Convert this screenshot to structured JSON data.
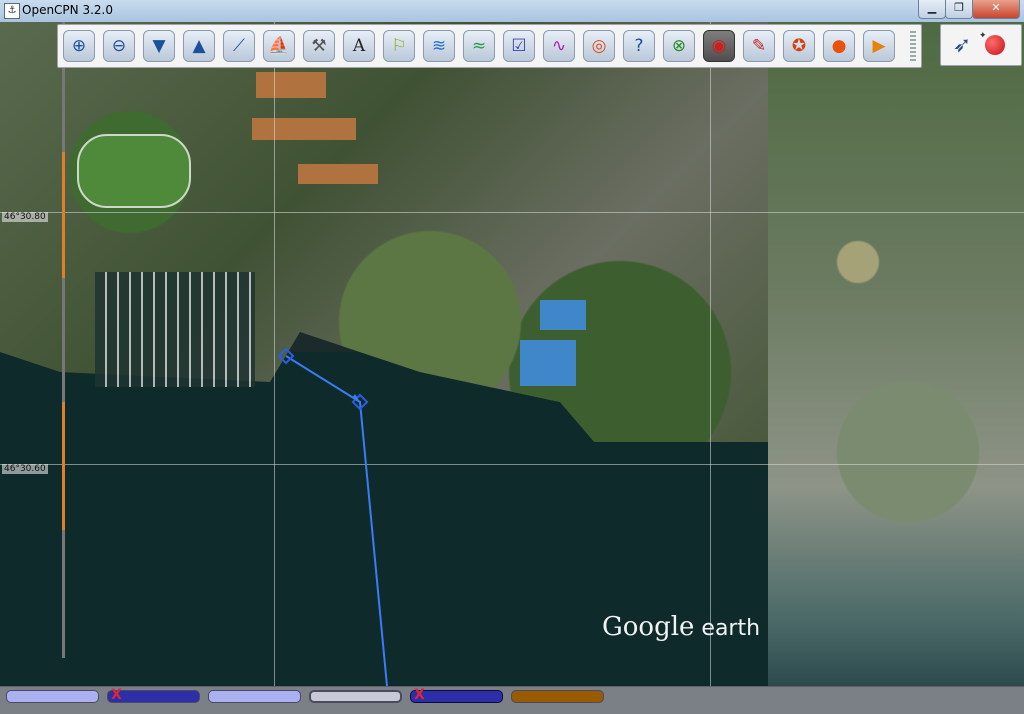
{
  "window": {
    "title": "OpenCPN 3.2.0",
    "minimize": "▁",
    "maximize": "❐",
    "close": "✕"
  },
  "toolbar": {
    "tools": [
      {
        "name": "zoom-in",
        "glyph": "⊕"
      },
      {
        "name": "zoom-out",
        "glyph": "⊖"
      },
      {
        "name": "scale-in",
        "glyph": "▼"
      },
      {
        "name": "scale-out",
        "glyph": "▲"
      },
      {
        "name": "create-route",
        "glyph": "⟋"
      },
      {
        "name": "auto-follow",
        "glyph": "⛵"
      },
      {
        "name": "settings",
        "glyph": "⚒"
      },
      {
        "name": "text",
        "glyph": "A"
      },
      {
        "name": "current",
        "glyph": "⚐"
      },
      {
        "name": "tide",
        "glyph": "≋"
      },
      {
        "name": "tide-graph",
        "glyph": "≈"
      },
      {
        "name": "route-manager",
        "glyph": "☑"
      },
      {
        "name": "track",
        "glyph": "∿"
      },
      {
        "name": "mob",
        "glyph": "◎"
      },
      {
        "name": "help",
        "glyph": "?"
      },
      {
        "name": "ais",
        "glyph": "⊗"
      },
      {
        "name": "radar",
        "glyph": "◉"
      },
      {
        "name": "print",
        "glyph": "✎"
      },
      {
        "name": "grib",
        "glyph": "✪"
      },
      {
        "name": "record-start",
        "glyph": "●"
      },
      {
        "name": "record-play",
        "glyph": "▶"
      }
    ]
  },
  "map": {
    "lat_labels": [
      "46°30.80",
      "46°30.60"
    ],
    "watermark_main": "Google",
    "watermark_sub": " earth"
  },
  "statusbar": {
    "chart_bars": [
      {
        "color": "#aab0f0",
        "crossed": false
      },
      {
        "color": "#2c2fa8",
        "crossed": true
      },
      {
        "color": "#aab0f0",
        "crossed": false
      },
      {
        "color": "#c7c9d6",
        "crossed": false
      },
      {
        "color": "#2c2fa8",
        "crossed": true
      },
      {
        "color": "#9a5a00",
        "crossed": false
      }
    ],
    "cross_mark": "X"
  },
  "colors": {
    "route": "#3a7cf4",
    "track_orange": "#e07f2b"
  }
}
